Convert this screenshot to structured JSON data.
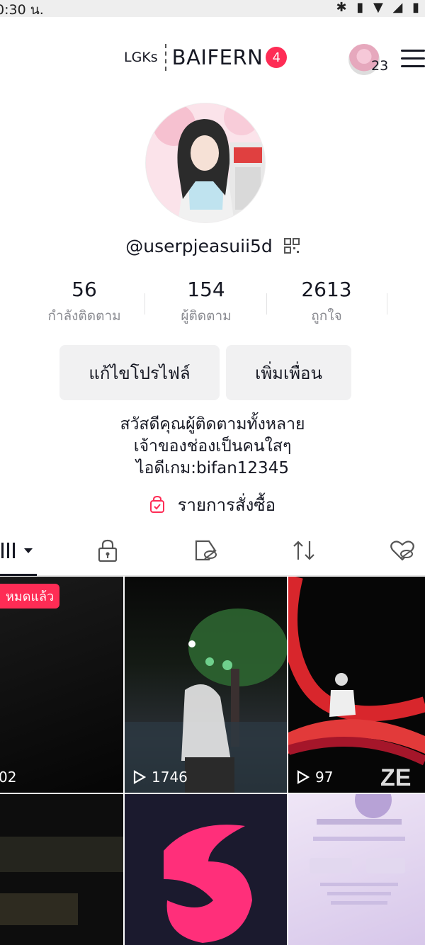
{
  "status_bar": {
    "time": "0:30 น.",
    "icons": "✱ ▮ ▼ ◢ ▮"
  },
  "header": {
    "brand_sub": "LGKs",
    "brand_name": "BAIFERN",
    "notification_count": "4",
    "followers_online": "23"
  },
  "profile": {
    "username": "@userpjeasuii5d"
  },
  "stats": [
    {
      "value": "56",
      "label": "กำลังติดตาม"
    },
    {
      "value": "154",
      "label": "ผู้ติดตาม"
    },
    {
      "value": "2613",
      "label": "ถูกใจ"
    }
  ],
  "actions": {
    "edit_profile": "แก้ไขโปรไฟล์",
    "add_friend": "เพิ่มเพื่อน"
  },
  "bio": {
    "line1": "สวัสดีคุณผู้ติดตามทั้งหลาย",
    "line2": "เจ้าของช่องเป็นคนใสๆ",
    "line3": "ไอดีเกม:bifan12345"
  },
  "orders_label": "รายการสั่งซื้อ",
  "tabs": [
    "videos-grid-icon",
    "lock-icon",
    "tag-hidden-icon",
    "repost-icon",
    "liked-hidden-icon"
  ],
  "videos": [
    {
      "views": "02",
      "badge": "หมดแล้ว"
    },
    {
      "views": "1746"
    },
    {
      "views": "97"
    },
    {
      "views": ""
    },
    {
      "views": ""
    },
    {
      "views": ""
    }
  ]
}
